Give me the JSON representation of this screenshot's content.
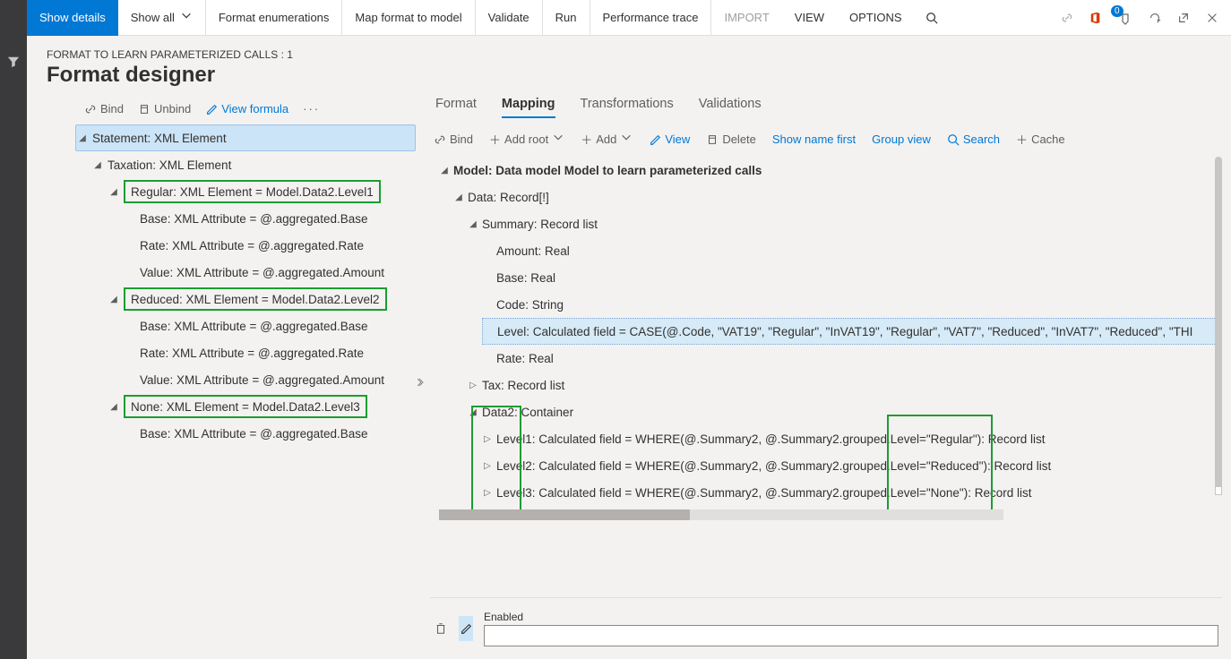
{
  "toolbar": {
    "show_details": "Show details",
    "show_all": "Show all",
    "format_enumerations": "Format enumerations",
    "map_format_to_model": "Map format to model",
    "validate": "Validate",
    "run": "Run",
    "performance_trace": "Performance trace",
    "import": "IMPORT",
    "view": "VIEW",
    "options": "OPTIONS",
    "notification_count": "0"
  },
  "breadcrumb": "FORMAT TO LEARN PARAMETERIZED CALLS : 1",
  "page_title": "Format designer",
  "left_toolbar": {
    "bind": "Bind",
    "unbind": "Unbind",
    "view_formula": "View formula"
  },
  "format_tree": {
    "root": "Statement: XML Element",
    "taxation": "Taxation: XML Element",
    "regular": "Regular: XML Element = Model.Data2.Level1",
    "regular_base": "Base: XML Attribute = @.aggregated.Base",
    "regular_rate": "Rate: XML Attribute = @.aggregated.Rate",
    "regular_value": "Value: XML Attribute = @.aggregated.Amount",
    "reduced": "Reduced: XML Element = Model.Data2.Level2",
    "reduced_base": "Base: XML Attribute = @.aggregated.Base",
    "reduced_rate": "Rate: XML Attribute = @.aggregated.Rate",
    "reduced_value": "Value: XML Attribute = @.aggregated.Amount",
    "none": "None: XML Element = Model.Data2.Level3",
    "none_base": "Base: XML Attribute = @.aggregated.Base"
  },
  "tabs": {
    "format": "Format",
    "mapping": "Mapping",
    "transformations": "Transformations",
    "validations": "Validations"
  },
  "map_toolbar": {
    "bind": "Bind",
    "add_root": "Add root",
    "add": "Add",
    "view": "View",
    "delete": "Delete",
    "show_name_first": "Show name first",
    "group_view": "Group view",
    "search": "Search",
    "cache": "Cache"
  },
  "mapping_tree": {
    "root": "Model: Data model Model to learn parameterized calls",
    "data": "Data: Record[!]",
    "summary": "Summary: Record list",
    "amount": "Amount: Real",
    "base": "Base: Real",
    "code": "Code: String",
    "level": "Level: Calculated field = CASE(@.Code, \"VAT19\", \"Regular\", \"InVAT19\", \"Regular\", \"VAT7\", \"Reduced\", \"InVAT7\", \"Reduced\", \"THI",
    "rate": "Rate: Real",
    "tax": "Tax: Record list",
    "data2": "Data2: Container",
    "level1": "Level1: Calculated field = WHERE(@.Summary2, @.Summary2.grouped.Level=\"Regular\"): Record list",
    "level2": "Level2: Calculated field = WHERE(@.Summary2, @.Summary2.grouped.Level=\"Reduced\"): Record list",
    "level3": "Level3: Calculated field = WHERE(@.Summary2, @.Summary2.grouped.Level=\"None\"): Record list"
  },
  "bottom": {
    "enabled_label": "Enabled"
  }
}
